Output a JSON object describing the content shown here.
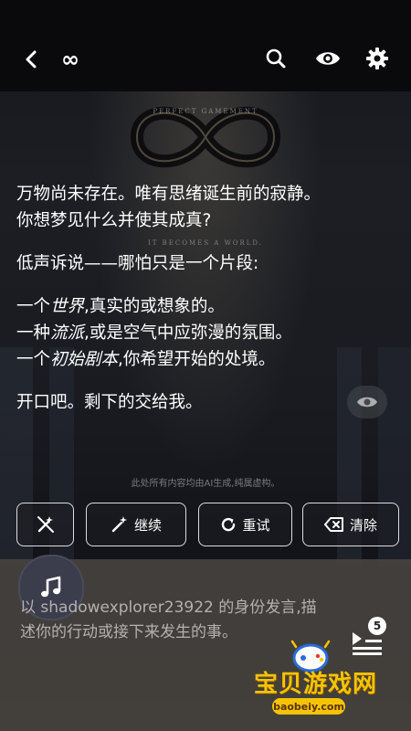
{
  "header": {
    "title_symbol": "∞",
    "icons": [
      "back-arrow-icon",
      "search-icon",
      "eye-icon",
      "gear-icon"
    ]
  },
  "hero": {
    "symbol": "∞",
    "subtitle_top": "PERFECT GAMEMENT",
    "subtitle_bottom": "IT BECOMES A WORLD."
  },
  "story": {
    "p1_line1": "万物尚未存在。唯有思绪诞生前的寂静。",
    "p1_line2": "你想梦见什么并使其成真?",
    "p2": "低声诉说——哪怕只是一个片段:",
    "p3_l1_a": "一个",
    "p3_l1_em": "世界",
    "p3_l1_b": ",真实的或想象的。",
    "p3_l2_a": "一种",
    "p3_l2_em": "流派",
    "p3_l2_b": ",或是空气中应弥漫的氛围。",
    "p3_l3_a": "一个",
    "p3_l3_em": "初始剧本",
    "p3_l3_b": ",你希望开始的处境。",
    "p4": "开口吧。剩下的交给我。"
  },
  "disclaimer": "此处所有内容均由AI生成,纯属虚构。",
  "actions": {
    "continue_label": "继续",
    "retry_label": "重试",
    "clear_label": "清除"
  },
  "composer": {
    "placeholder": "以 shadowexplorer23922 的身份发言,描述你的行动或接下来发生的事。",
    "queue_count": "5"
  },
  "watermark": {
    "text": "宝贝游戏网",
    "url": "baobeiy.com"
  },
  "colors": {
    "topbar": "#0a0a0c",
    "composer": "#46423e",
    "watermark": "#f5c400"
  }
}
